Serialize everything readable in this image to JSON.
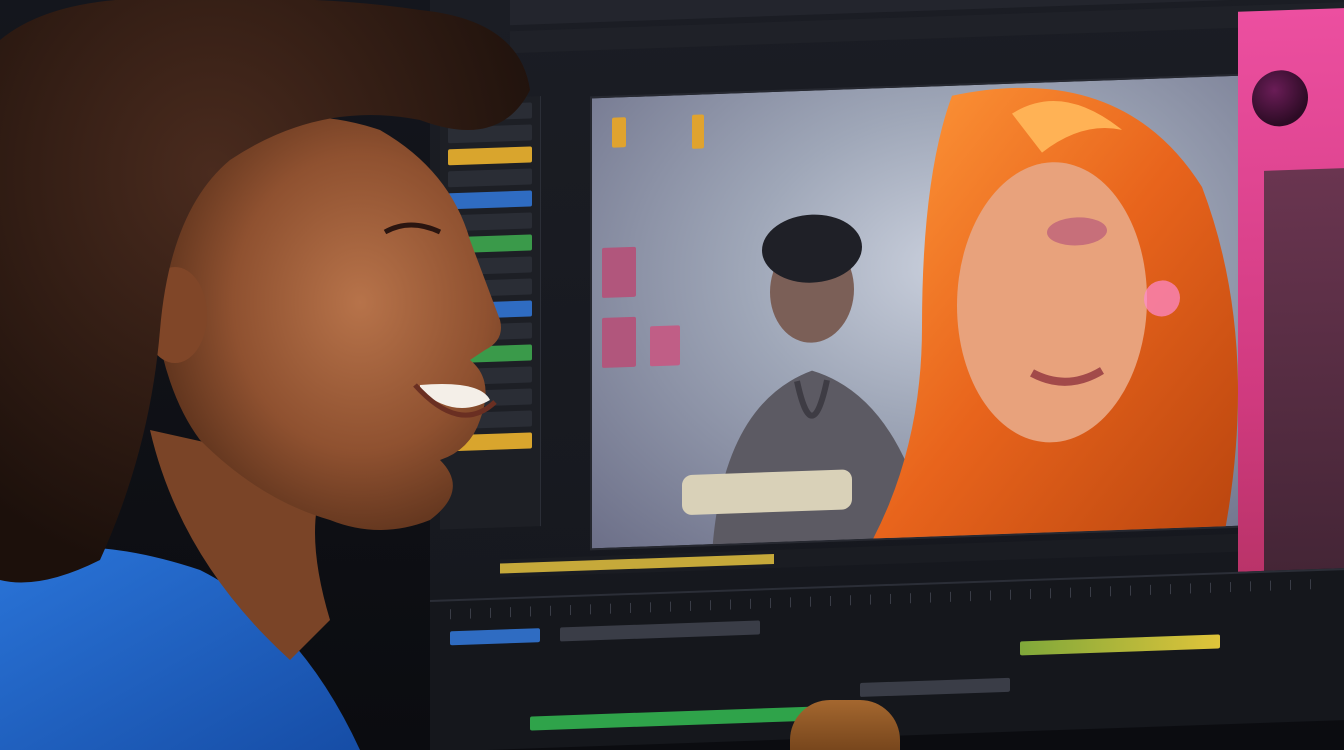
{
  "editor": {
    "top_bar_items": [
      "",
      "",
      ""
    ],
    "badge_label": "",
    "accent_color": "#e0a32e",
    "panel_color": "#ec4fa0"
  },
  "preview": {
    "progress_fraction": 0.36
  },
  "icons": {
    "playhead": "playhead-icon"
  }
}
